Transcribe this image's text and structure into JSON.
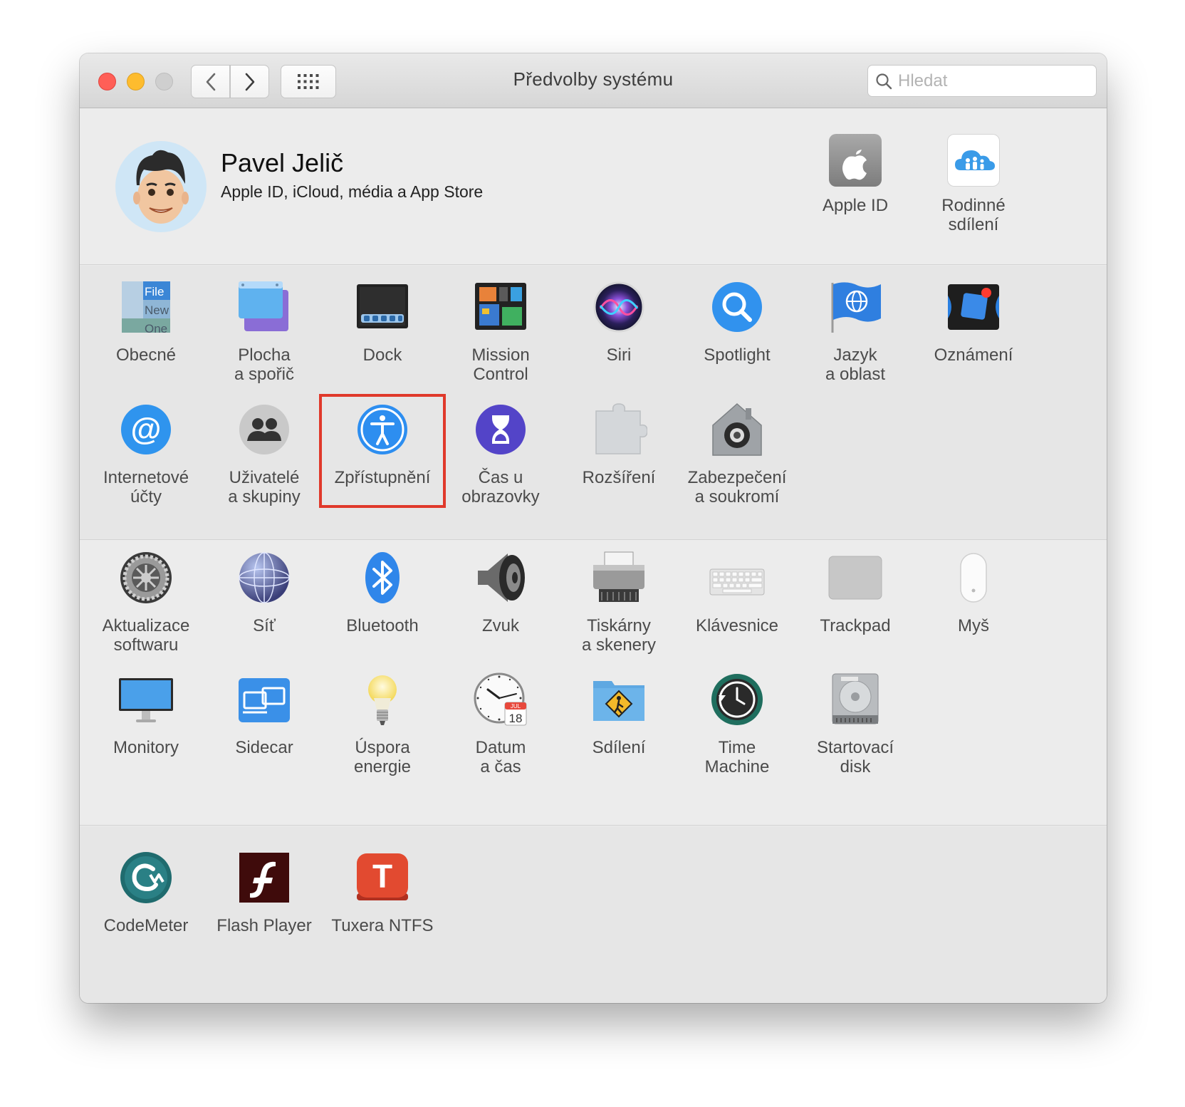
{
  "window": {
    "title": "Předvolby systému",
    "search_placeholder": "Hledat"
  },
  "account": {
    "name": "Pavel Jelič",
    "subtitle": "Apple ID, iCloud, média a App Store",
    "items": [
      {
        "label": "Apple ID",
        "icon": "apple-id-icon"
      },
      {
        "label": "Rodinné\nsdílení",
        "icon": "family-sharing-icon"
      }
    ]
  },
  "sections": [
    {
      "panes": [
        {
          "label": "Obecné",
          "icon": "general-icon"
        },
        {
          "label": "Plocha\na spořič",
          "icon": "desktop-screensaver-icon"
        },
        {
          "label": "Dock",
          "icon": "dock-icon"
        },
        {
          "label": "Mission\nControl",
          "icon": "mission-control-icon"
        },
        {
          "label": "Siri",
          "icon": "siri-icon"
        },
        {
          "label": "Spotlight",
          "icon": "spotlight-icon"
        },
        {
          "label": "Jazyk\na oblast",
          "icon": "language-region-icon"
        },
        {
          "label": "Oznámení",
          "icon": "notifications-icon"
        },
        {
          "label": "Internetové\núčty",
          "icon": "internet-accounts-icon"
        },
        {
          "label": "Uživatelé\na skupiny",
          "icon": "users-groups-icon"
        },
        {
          "label": "Zpřístupnění",
          "icon": "accessibility-icon",
          "highlighted": true
        },
        {
          "label": "Čas u obrazovky",
          "icon": "screen-time-icon"
        },
        {
          "label": "Rozšíření",
          "icon": "extensions-icon"
        },
        {
          "label": "Zabezpečení\na soukromí",
          "icon": "security-privacy-icon"
        }
      ]
    },
    {
      "panes": [
        {
          "label": "Aktualizace\nsoftwaru",
          "icon": "software-update-icon"
        },
        {
          "label": "Síť",
          "icon": "network-icon"
        },
        {
          "label": "Bluetooth",
          "icon": "bluetooth-icon"
        },
        {
          "label": "Zvuk",
          "icon": "sound-icon"
        },
        {
          "label": "Tiskárny\na skenery",
          "icon": "printers-scanners-icon"
        },
        {
          "label": "Klávesnice",
          "icon": "keyboard-icon"
        },
        {
          "label": "Trackpad",
          "icon": "trackpad-icon"
        },
        {
          "label": "Myš",
          "icon": "mouse-icon"
        },
        {
          "label": "Monitory",
          "icon": "displays-icon"
        },
        {
          "label": "Sidecar",
          "icon": "sidecar-icon"
        },
        {
          "label": "Úspora\nenergie",
          "icon": "energy-saver-icon"
        },
        {
          "label": "Datum\na čas",
          "icon": "date-time-icon"
        },
        {
          "label": "Sdílení",
          "icon": "sharing-icon"
        },
        {
          "label": "Time\nMachine",
          "icon": "time-machine-icon"
        },
        {
          "label": "Startovací\ndisk",
          "icon": "startup-disk-icon"
        }
      ]
    },
    {
      "panes": [
        {
          "label": "CodeMeter",
          "icon": "codemeter-icon"
        },
        {
          "label": "Flash Player",
          "icon": "flash-player-icon"
        },
        {
          "label": "Tuxera NTFS",
          "icon": "tuxera-ntfs-icon"
        }
      ]
    }
  ],
  "icon_text": {
    "general_file": "File",
    "general_new": "New",
    "general_one": "One",
    "calendar_month": "JUL",
    "calendar_day": "18",
    "tuxera_letter": "T"
  },
  "colors": {
    "highlight_border": "#e0392b",
    "close": "#ff5f57",
    "minimize": "#febc2e"
  }
}
